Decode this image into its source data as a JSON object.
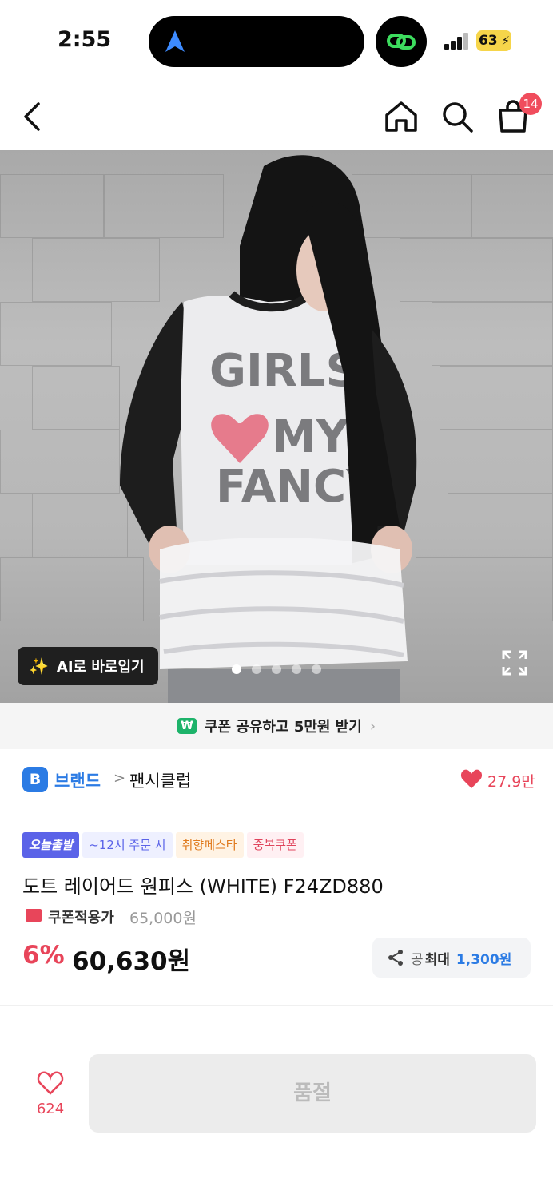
{
  "status_bar": {
    "time": "2:55",
    "battery_level": "63",
    "battery_color": "#f6d54a"
  },
  "header": {
    "back_icon": "chevron-left-icon",
    "home_icon": "home-icon",
    "search_icon": "search-icon",
    "cart_icon": "shopping-bag-icon",
    "cart_badge": "14",
    "badge_color": "#f04d5d"
  },
  "hero": {
    "ai_button_label": "AI로 바로입기",
    "ai_icon": "magic-wand-icon",
    "expand_icon": "expand-icon",
    "carousel_total": 5,
    "carousel_active": 1
  },
  "coupon_banner": {
    "icon": "won-badge-icon",
    "icon_text": "₩",
    "text": "쿠폰 공유하고 5만원 받기"
  },
  "brand": {
    "logo_letter": "B",
    "label": "브랜드",
    "name": "팬시클럽",
    "like_count": "27.9만",
    "accent_color": "#2b7be4"
  },
  "product": {
    "tags": [
      "오늘출발",
      "~12시 주문 시",
      "취향페스타",
      "중복쿠폰"
    ],
    "title": "도트 레이어드 원피스 (WHITE) F24ZD880",
    "coupon_label": "쿠폰적용가",
    "original_price": "65,000원",
    "discount": "6%",
    "price": "60,630원",
    "share_prefix": "공",
    "share_label": "최대",
    "share_amount": "1,300원",
    "price_color": "#e8455a"
  },
  "bottom_bar": {
    "wish_count": "624",
    "soldout_label": "품절"
  }
}
